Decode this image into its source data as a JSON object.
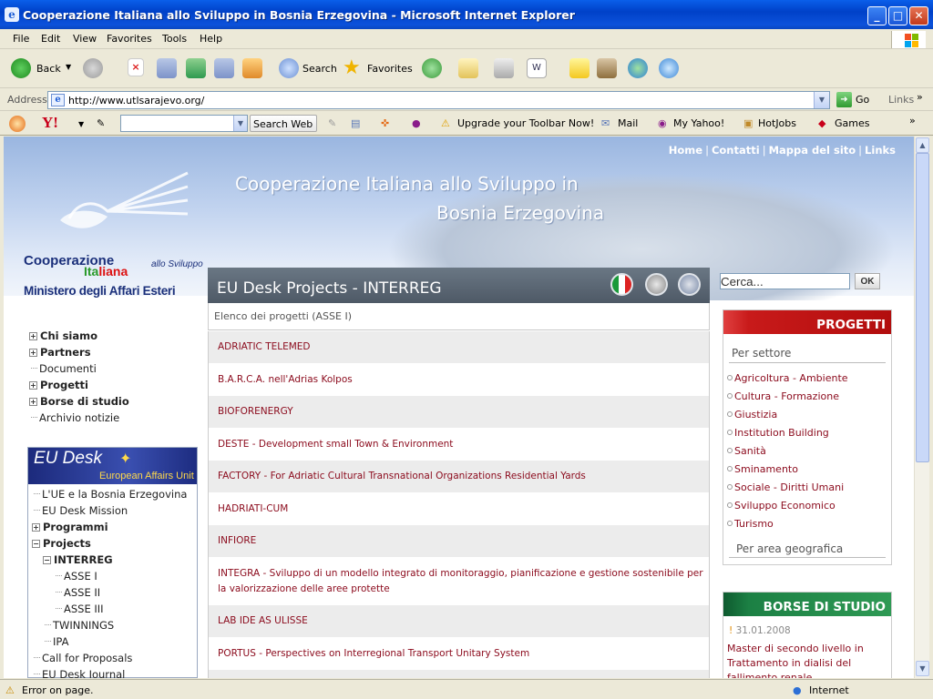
{
  "window": {
    "title": "Cooperazione Italiana allo Sviluppo in Bosnia Erzegovina - Microsoft Internet Explorer"
  },
  "menu": [
    "File",
    "Edit",
    "View",
    "Favorites",
    "Tools",
    "Help"
  ],
  "toolbar": {
    "back": "Back",
    "search": "Search",
    "favorites": "Favorites"
  },
  "address": {
    "label": "Address",
    "url": "http://www.utlsarajevo.org/",
    "go": "Go",
    "links": "Links"
  },
  "yahoo": {
    "search_web": "Search Web",
    "upgrade": "Upgrade your Toolbar Now!",
    "mail": "Mail",
    "myyahoo": "My Yahoo!",
    "hotjobs": "HotJobs",
    "games": "Games"
  },
  "site": {
    "toplinks": [
      "Home",
      "Contatti",
      "Mappa del sito",
      "Links"
    ],
    "title_line1": "Cooperazione Italiana allo Sviluppo in",
    "title_line2": "Bosnia Erzegovina",
    "logo": {
      "l1": "Cooperazione",
      "l2a": "Ita",
      "l2b": "liana",
      "l3": "allo Sviluppo",
      "l4": "Ministero degli Affari Esteri"
    }
  },
  "nav": [
    {
      "label": "Chi siamo",
      "type": "plus"
    },
    {
      "label": "Partners",
      "type": "plus"
    },
    {
      "label": "Documenti",
      "type": "leaf"
    },
    {
      "label": "Progetti",
      "type": "plus"
    },
    {
      "label": "Borse di studio",
      "type": "plus"
    },
    {
      "label": "Archivio notizie",
      "type": "leaf"
    }
  ],
  "eudesk": {
    "title": "EU Desk",
    "subtitle": "European Affairs Unit",
    "items": [
      {
        "label": "L'UE e la Bosnia Erzegovina"
      },
      {
        "label": "EU Desk Mission"
      },
      {
        "label": "Programmi"
      },
      {
        "label": "Projects"
      },
      {
        "label": "INTERREG"
      },
      {
        "label": "ASSE I"
      },
      {
        "label": "ASSE II"
      },
      {
        "label": "ASSE III"
      },
      {
        "label": "TWINNINGS"
      },
      {
        "label": "IPA"
      },
      {
        "label": "Call for Proposals"
      },
      {
        "label": "EU Desk Journal"
      }
    ]
  },
  "content": {
    "title": "EU Desk Projects - INTERREG",
    "subtitle": "Elenco dei progetti (ASSE I)",
    "projects": [
      "ADRIATIC TELEMED",
      "B.A.R.C.A. nell'Adrias Kolpos",
      "BIOFORENERGY",
      "DESTE - Development small Town & Environment",
      "FACTORY - For Adriatic Cultural Transnational Organizations Residential Yards",
      "HADRIATI-CUM",
      "INFIORE",
      "INTEGRA - Sviluppo di un modello integrato di monitoraggio, pianificazione e gestione sostenibile per la valorizzazione delle aree protette",
      "LAB IDE AS ULISSE",
      "PORTUS - Perspectives on Interregional Transport Unitary System"
    ]
  },
  "search": {
    "placeholder": "Cerca...",
    "ok": "OK"
  },
  "progetti": {
    "title": "PROGETTI",
    "per_settore": "Per settore",
    "settori": [
      "Agricoltura - Ambiente",
      "Cultura - Formazione",
      "Giustizia",
      "Institution Building",
      "Sanità",
      "Sminamento",
      "Sociale - Diritti Umani",
      "Sviluppo Economico",
      "Turismo"
    ],
    "per_area": "Per area geografica"
  },
  "borse": {
    "title": "BORSE DI STUDIO",
    "date": "31.01.2008",
    "text": "Master di secondo livello in Trattamento in dialisi del fallimento renale"
  },
  "status": {
    "left": "Error on page.",
    "zone": "Internet"
  },
  "colors": {
    "link_red": "#8b0a1c",
    "progetti_red": "#b20d0d",
    "borse_green": "#1c8044",
    "header_grey": "#5a6572"
  }
}
